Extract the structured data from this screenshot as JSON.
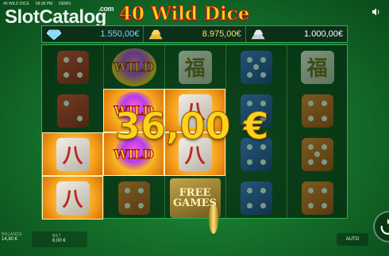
{
  "status_bar": {
    "game": "40 WILD DICE",
    "time": "08:38 PM",
    "mode": "DEMO"
  },
  "watermark": {
    "name": "SlotCatalog",
    "suffix": ".com"
  },
  "game_title": "40 Wild Dice",
  "jackpots": [
    {
      "icon": "diamond-icon",
      "value": "1.550,00€"
    },
    {
      "icon": "gold-bars-icon",
      "value": "8.975,00€"
    },
    {
      "icon": "silver-bars-icon",
      "value": "1.000,00€"
    }
  ],
  "reels": {
    "wild_label": "WILD",
    "free_games_label_1": "FREE",
    "free_games_label_2": "GAMES",
    "tile_glyph": "八",
    "tile_glyph_alt": "福"
  },
  "win": {
    "amount": "36,00 €"
  },
  "bottom": {
    "balance_label": "BALANCE",
    "balance_value": "14,80 €",
    "bet_label": "BET",
    "bet_value": "8,00 €",
    "auto_label": "AUTO"
  },
  "colors": {
    "accent_gold": "#ffd21a",
    "background_green": "#16752d"
  }
}
